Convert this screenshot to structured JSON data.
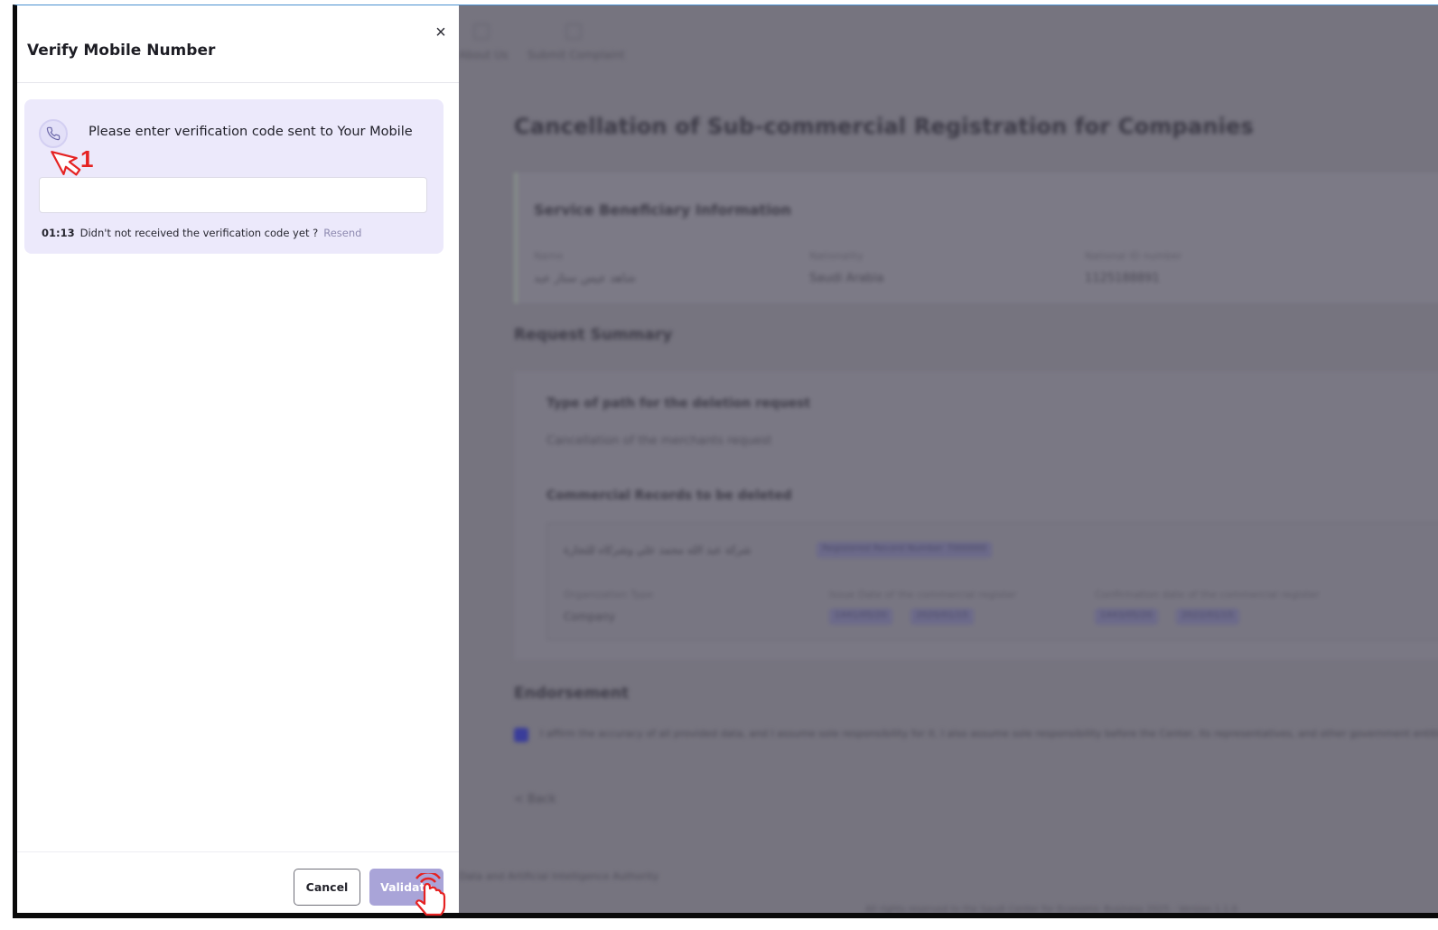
{
  "modal": {
    "title": "Verify Mobile Number",
    "close_label": "×",
    "verify_message": "Please enter verification code sent to Your Mobile",
    "code_value": "",
    "timer": "01:13",
    "not_received_text": "Didn't not received the verification code yet ?",
    "resend_label": "Resend",
    "cancel_label": "Cancel",
    "validate_label": "Validate"
  },
  "annotation": {
    "step_number": "1",
    "color": "#e52222"
  },
  "background": {
    "nav": [
      "About Us",
      "Submit Complaint"
    ],
    "page_title": "Cancellation of Sub-commercial Registration for Companies",
    "beneficiary": {
      "title": "Service Beneficiary Information",
      "fields": [
        {
          "label": "Name",
          "value": "شاهد عيس ستار عبد"
        },
        {
          "label": "Nationality",
          "value": "Saudi Arabia"
        },
        {
          "label": "National ID number",
          "value": "1125188891"
        }
      ]
    },
    "request_summary": {
      "title": "Request Summary",
      "items": [
        {
          "title": "Type of path for the deletion request",
          "value": "Cancellation of the merchants request"
        },
        {
          "title": "Commercial Records to be deleted",
          "value": ""
        }
      ],
      "record": {
        "name": "شركة عبد الله محمد علي وشركاه للتجارة",
        "chip": "Registered Record Number 7000000",
        "fields": [
          {
            "label": "Organization Type",
            "value": "Company"
          },
          {
            "label": "Issue Date of the commercial register",
            "chips": [
              "1441/05/20",
              "2020/01/15"
            ]
          },
          {
            "label": "Confirmation date of the commercial register",
            "chips": [
              "1443/05/20",
              "2022/01/15"
            ]
          }
        ]
      }
    },
    "endorsement": {
      "title": "Endorsement",
      "text": "I affirm the accuracy of all provided data, and I assume sole responsibility for it. I also assume sole responsibility before the Center, its representatives, and other government entities"
    },
    "back_label": "< Back",
    "footer_line_1": "Data and Artificial Intelligence Authority",
    "footer_line_2": "All rights reserved to the Saudi Center for Economic Business 2025 - Version 1.1.0"
  }
}
